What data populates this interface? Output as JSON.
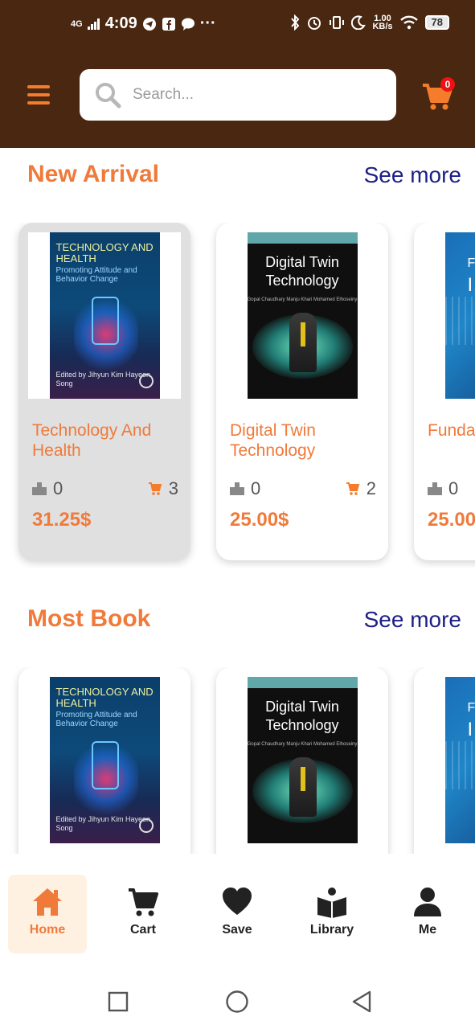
{
  "status_bar": {
    "network": "4G",
    "time": "4:09",
    "data_rate": "1.00",
    "data_rate_unit": "KB/s",
    "battery": "78"
  },
  "header": {
    "search_placeholder": "Search...",
    "cart_count": "0"
  },
  "sections": [
    {
      "title": "New Arrival",
      "see_more": "See more",
      "books": [
        {
          "title": "Technology And Health",
          "likes": "0",
          "in_cart": "3",
          "price": "31.25$",
          "selected": true
        },
        {
          "title": "Digital Twin Technology",
          "likes": "0",
          "in_cart": "2",
          "price": "25.00$"
        },
        {
          "title": "Funda Of Info",
          "likes": "0",
          "price": "25.00"
        }
      ]
    },
    {
      "title": "Most Book",
      "see_more": "See more"
    }
  ],
  "covers": {
    "health": {
      "title": "TECHNOLOGY AND HEALTH",
      "subtitle": "Promoting Attitude and Behavior Change",
      "editors": "Edited by Jihyun Kim Hayeon Song"
    },
    "twin": {
      "title": "Digital Twin Technology",
      "authors": "Gopal Chaudhary Manju Khari Mohamed Elhoseiny"
    },
    "fund": {
      "letter": "F",
      "big": "I"
    }
  },
  "bottom_nav": {
    "items": [
      {
        "label": "Home",
        "icon": "home-icon",
        "active": true
      },
      {
        "label": "Cart",
        "icon": "cart-icon"
      },
      {
        "label": "Save",
        "icon": "heart-icon"
      },
      {
        "label": "Library",
        "icon": "library-icon"
      },
      {
        "label": "Me",
        "icon": "user-icon"
      }
    ]
  },
  "colors": {
    "header_bg": "#4a2710",
    "accent": "#f07a3a",
    "link": "#1d1f86",
    "active_nav_bg": "#fff1e2"
  }
}
